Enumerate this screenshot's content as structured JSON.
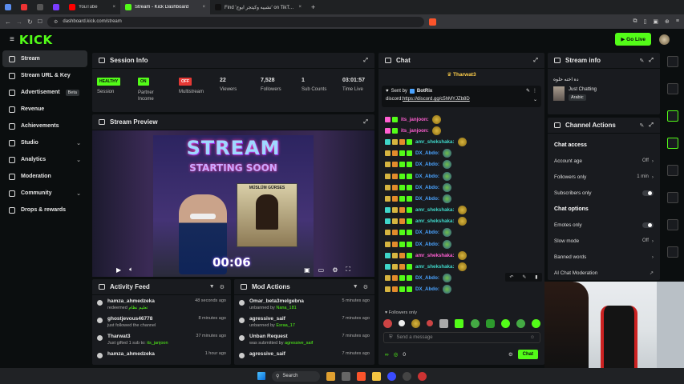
{
  "browser": {
    "tabs": [
      {
        "label": "",
        "color": "#5b8def"
      },
      {
        "label": "",
        "color": "#e33"
      },
      {
        "label": "",
        "color": "#555"
      },
      {
        "label": "",
        "color": "#7a3cff"
      },
      {
        "label": "YouTube",
        "color": "#ff0000"
      },
      {
        "label": "Stream - Kick Dashboard",
        "color": "#53fc18",
        "active": true
      },
      {
        "label": "Find 'تشبيه وكيتجر ابوج' on TikTok | Tik",
        "color": "#111"
      }
    ],
    "url": "dashboard.kick.com/stream"
  },
  "header": {
    "logo": "KICK",
    "go_live": "Go Live"
  },
  "sidebar": {
    "items": [
      {
        "label": "Stream",
        "active": true
      },
      {
        "label": "Stream URL & Key"
      },
      {
        "label": "Advertisement",
        "badge": "Beta"
      },
      {
        "label": "Revenue"
      },
      {
        "label": "Achievements"
      },
      {
        "label": "Studio",
        "chevron": true
      },
      {
        "label": "Analytics",
        "chevron": true
      },
      {
        "label": "Moderation"
      },
      {
        "label": "Community",
        "chevron": true
      },
      {
        "label": "Drops & rewards"
      }
    ]
  },
  "session": {
    "title": "Session Info",
    "session_badge": "HEALTHY",
    "session_label": "Session",
    "partner_badge": "ON",
    "partner_label": "Partner Income",
    "multistream_badge": "OFF",
    "multistream_label": "Multistream",
    "viewers": "22",
    "viewers_label": "Viewers",
    "followers": "7,528",
    "followers_label": "Followers",
    "subs": "1",
    "subs_label": "Sub Counts",
    "live_time": "03:01:57",
    "live_time_label": "Time Live"
  },
  "preview": {
    "title": "Stream Preview",
    "line1": "STREAM",
    "line2": "STARTING SOON",
    "poster_name": "MÜSLÜM GÜRSES",
    "countdown": "00:06"
  },
  "activity": {
    "title": "Activity Feed",
    "items": [
      {
        "user": "hamza_ahmedzeka",
        "action": "redeemed",
        "detail": "تعليم نظام",
        "time": "48 seconds ago"
      },
      {
        "user": "ghostjevous46778",
        "action": "just followed the channel",
        "detail": "",
        "time": "8 minutes ago"
      },
      {
        "user": "Tharwat3",
        "action": "Just gifted 1 sub to:",
        "detail": "its_janjoon",
        "time": "37 minutes ago"
      },
      {
        "user": "hamza_ahmedzeka",
        "action": "",
        "detail": "",
        "time": "1 hour ago"
      }
    ]
  },
  "mod": {
    "title": "Mod Actions",
    "items": [
      {
        "user": "Omar_beta3melgebna",
        "action": "unbanned by",
        "by": "Nana_181",
        "time": "5 minutes ago"
      },
      {
        "user": "agressive_saif",
        "action": "unbanned by",
        "by": "Esraa_17",
        "time": "7 minutes ago"
      },
      {
        "user": "Unban Request",
        "action": "was submitted by",
        "by": "agressive_saif",
        "time": "7 minutes ago"
      },
      {
        "user": "agressive_saif",
        "action": "",
        "by": "",
        "time": "7 minutes ago"
      }
    ]
  },
  "chat": {
    "title": "Chat",
    "pinned_user": "Tharwat3",
    "sent_by_label": "Sent by",
    "sent_by_user": "BotRix",
    "pinned_prefix": "discord:",
    "pinned_link": "https://discord.gg/c5hMYJZb8D",
    "messages": [
      {
        "user": "its_janjoon:",
        "color": "#ff5fd1"
      },
      {
        "user": "its_janjoon:",
        "color": "#ff5fd1"
      },
      {
        "user": "amr_shekshaka:",
        "color": "#3fd6c8"
      },
      {
        "user": "DX_Abdo:",
        "color": "#4aa3ff"
      },
      {
        "user": "DX_Abdo:",
        "color": "#4aa3ff"
      },
      {
        "user": "DX_Abdo:",
        "color": "#4aa3ff"
      },
      {
        "user": "DX_Abdo:",
        "color": "#4aa3ff"
      },
      {
        "user": "DX_Abdo:",
        "color": "#4aa3ff"
      },
      {
        "user": "amr_shekshaka:",
        "color": "#3fd6c8"
      },
      {
        "user": "amr_shekshaka:",
        "color": "#3fd6c8"
      },
      {
        "user": "DX_Abdo:",
        "color": "#4aa3ff"
      },
      {
        "user": "DX_Abdo:",
        "color": "#4aa3ff"
      },
      {
        "user": "amr_shekshaka:",
        "color": "#ff5fd1"
      },
      {
        "user": "amr_shekshaka:",
        "color": "#3fd6c8"
      },
      {
        "user": "DX_Abdo:",
        "color": "#4aa3ff"
      },
      {
        "user": "DX_Abdo:",
        "color": "#4aa3ff"
      }
    ],
    "followers_only": "Followers only",
    "placeholder": "Send a message",
    "count": "0",
    "chat_button": "Chat"
  },
  "stream_info": {
    "title": "Stream info",
    "stream_title": "ده اخته حلوه",
    "category": "Just Chatting",
    "language": "Arabic"
  },
  "channel_actions": {
    "title": "Channel Actions",
    "access_header": "Chat access",
    "account_age": "Account age",
    "account_age_val": "Off",
    "followers_only": "Followers only",
    "followers_only_val": "1 min",
    "subscribers_only": "Subscribers only",
    "options_header": "Chat options",
    "emotes_only": "Emotes only",
    "slow_mode": "Slow mode",
    "slow_mode_val": "Off",
    "banned_words": "Banned words",
    "ai_moderation": "AI Chat Moderation"
  },
  "taskbar": {
    "search": "Search"
  }
}
